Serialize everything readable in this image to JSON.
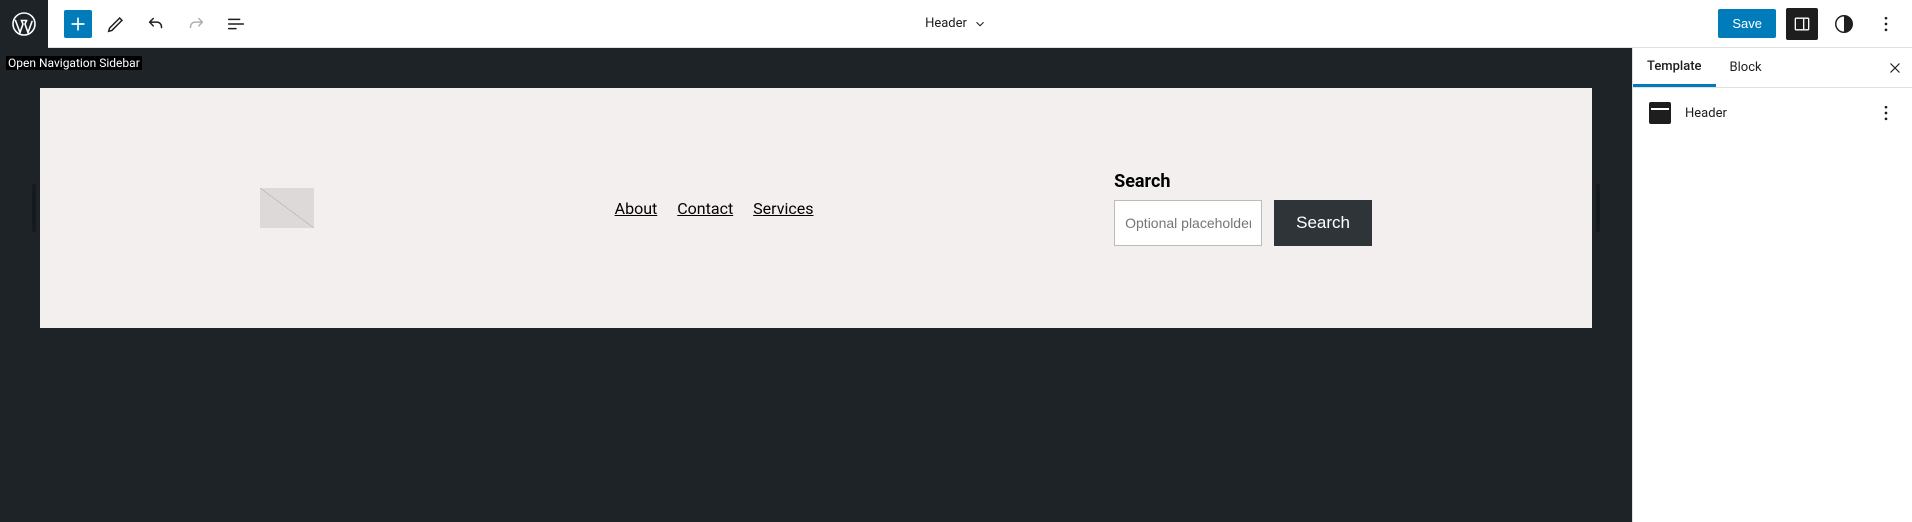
{
  "topbar": {
    "center_label": "Header",
    "save_label": "Save"
  },
  "tooltip": "Open Navigation Sidebar",
  "nav": {
    "items": [
      "About",
      "Contact",
      "Services"
    ]
  },
  "search": {
    "label": "Search",
    "placeholder": "Optional placeholder…",
    "button_label": "Search"
  },
  "sidebar": {
    "tabs": [
      "Template",
      "Block"
    ],
    "panel_title": "Header"
  },
  "colors": {
    "primary": "#007cba",
    "dark": "#1d2327",
    "canvas_bg": "#f3efef"
  }
}
